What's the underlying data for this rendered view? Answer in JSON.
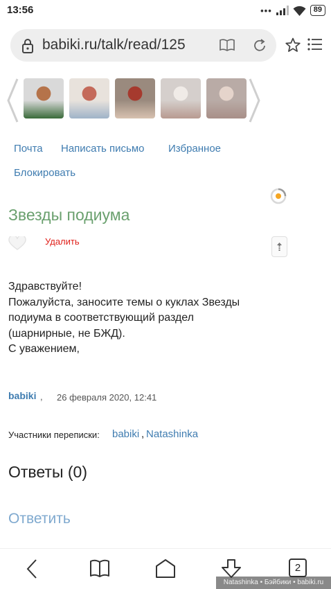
{
  "status_bar": {
    "time": "13:56",
    "signal_dots": "•••",
    "battery": "89",
    "icons": [
      "signal-icon",
      "wifi-icon",
      "battery-icon"
    ]
  },
  "browser": {
    "url": "babiki.ru/talk/read/125",
    "icons": [
      "lock-icon",
      "reader-mode-icon",
      "reload-icon",
      "bookmark-star-icon",
      "menu-icon"
    ]
  },
  "gallery": {
    "thumbnails": [
      {
        "name": "doll-red-hair",
        "colors": [
          "#d9d9d9",
          "#b5734a",
          "#3a6b3a"
        ]
      },
      {
        "name": "doll-collage",
        "colors": [
          "#e8e2dc",
          "#c46a5a",
          "#9fb3c8"
        ]
      },
      {
        "name": "doll-red-hood",
        "colors": [
          "#9a8a7e",
          "#a63a2e",
          "#d8c2b0"
        ]
      },
      {
        "name": "doll-white-hair",
        "colors": [
          "#d5cfcc",
          "#f0ebe7",
          "#b89a90"
        ]
      },
      {
        "name": "doll-bodies",
        "colors": [
          "#b9aba6",
          "#e5d4cb",
          "#a88f88"
        ]
      }
    ]
  },
  "actions": {
    "mail": "Почта",
    "write_letter": "Написать письмо",
    "favorites": "Избранное",
    "block": "Блокировать"
  },
  "post": {
    "title": "Звезды подиума",
    "delete": "Удалить",
    "lines": [
      "Здравствуйте!",
      "Пожалуйста, заносите темы о куклах Звезды",
      "подиума в соответствующий раздел",
      "(шарнирные, не БЖД).",
      "С уважением,"
    ],
    "author": "babiki",
    "comma": ",",
    "date": "26 февраля 2020, 12:41"
  },
  "participants": {
    "label": "Участники переписки:",
    "users": [
      "babiki",
      "Natashinka"
    ],
    "separator": ","
  },
  "replies": {
    "title": "Ответы (0)",
    "reply": "Ответить"
  },
  "bottom_nav": {
    "tab_count": "2",
    "icons": [
      "back-icon",
      "bookmarks-icon",
      "home-icon",
      "downloads-icon",
      "tabs-icon"
    ]
  },
  "watermark": "Natashinka • Бэйбики • babiki.ru",
  "colors": {
    "link": "#3f7cb0",
    "title_green": "#6aa06e",
    "delete_red": "#e0201a",
    "reply_link": "#7fa9cf",
    "accent_orange": "#f5a623"
  }
}
